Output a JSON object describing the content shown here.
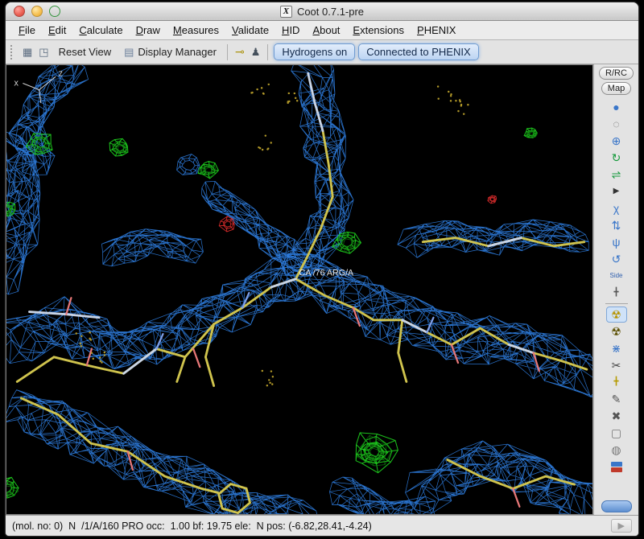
{
  "window": {
    "title": "Coot 0.7.1-pre"
  },
  "menu": {
    "items": [
      "File",
      "Edit",
      "Calculate",
      "Draw",
      "Measures",
      "Validate",
      "HID",
      "About",
      "Extensions",
      "PHENIX"
    ]
  },
  "toolbar": {
    "left_icons": [
      {
        "name": "scene-icon",
        "glyph": "▦"
      },
      {
        "name": "stereo-view-icon",
        "glyph": "◳"
      }
    ],
    "reset_view": "Reset View",
    "display_manager_icon": "▤",
    "display_manager": "Display Manager",
    "key_icon": "⊸",
    "figure_icon": "♟",
    "hydrogens_toggle": "Hydrogens on",
    "phenix_toggle": "Connected to PHENIX"
  },
  "right_panel": {
    "rrc_label": "R/RC",
    "map_label": "Map",
    "icons": [
      {
        "name": "rotate-sphere-icon",
        "glyph": "●",
        "color": "#3a76c9"
      },
      {
        "name": "spin-view-icon",
        "glyph": "◌",
        "color": "#666666"
      },
      {
        "name": "translate-view-icon",
        "glyph": "⊕",
        "color": "#3a76c9"
      },
      {
        "name": "rotate-zoom-icon",
        "glyph": "↻",
        "color": "#169a3c"
      },
      {
        "name": "rock-view-icon",
        "glyph": "⇌",
        "color": "#169a3c"
      },
      {
        "name": "expand-icon",
        "glyph": "▶",
        "color": "#333333",
        "small": true
      },
      {
        "name": "chi-angles-icon",
        "glyph": "χ",
        "color": "#3a76c9"
      },
      {
        "name": "jump-residue-icon",
        "glyph": "⇅",
        "color": "#3a76c9"
      },
      {
        "name": "torsion-icon",
        "glyph": "ψ",
        "color": "#3a76c9"
      },
      {
        "name": "sphere-refine-icon",
        "glyph": "↺",
        "color": "#3a76c9"
      },
      {
        "name": "side-view-icon",
        "glyph": "Side",
        "color": "#2f5fae",
        "text": true
      },
      {
        "name": "axes-icon",
        "glyph": "╋",
        "color": "#555555",
        "small": true
      },
      {
        "sep": true
      },
      {
        "name": "xray-refine-icon",
        "glyph": "☢",
        "color": "#b79400",
        "active": true
      },
      {
        "name": "xray-map-icon",
        "glyph": "☢",
        "color": "#5a4e00"
      },
      {
        "name": "add-terminal-residue-icon",
        "glyph": "⋇",
        "color": "#3a76c9"
      },
      {
        "name": "cut-icon",
        "glyph": "✂",
        "color": "#444444"
      },
      {
        "name": "add-atom-icon",
        "glyph": "╋",
        "color": "#b59a00",
        "small": true
      },
      {
        "name": "pencil-icon",
        "glyph": "✎",
        "color": "#555555"
      },
      {
        "name": "delete-icon",
        "glyph": "✖",
        "color": "#555555"
      },
      {
        "name": "box-icon",
        "glyph": "▢",
        "color": "#777777"
      },
      {
        "name": "sphere-icon",
        "glyph": "◍",
        "color": "#777777"
      },
      {
        "name": "rama-plot-icon",
        "duo": true,
        "color": "#3a76c9",
        "color2": "#c03a2b"
      }
    ]
  },
  "canvas": {
    "atom_label": "CA /76 ARG/A",
    "axis_x_label": "x",
    "axis_z_label": "z",
    "colors": {
      "density_mesh": "#2d7de0",
      "difference_positive": "#1ecb1e",
      "difference_positive_dark": "#0f7a0f",
      "difference_negative": "#d42a2a",
      "carbon_sticks": "#cfc34d",
      "pale_sticks": "#c9d4e6",
      "oxygen_tick": "#e87878",
      "nitrogen_tick": "#7f9fe8",
      "water_dots": "#b99f2a",
      "background": "#000000",
      "label_text": "#e8e8e8"
    }
  },
  "statusbar": {
    "text": "(mol. no: 0)  N  /1/A/160 PRO occ:  1.00 bf: 19.75 ele:  N pos: (-6.82,28.41,-4.24)",
    "play_glyph": "▶"
  }
}
